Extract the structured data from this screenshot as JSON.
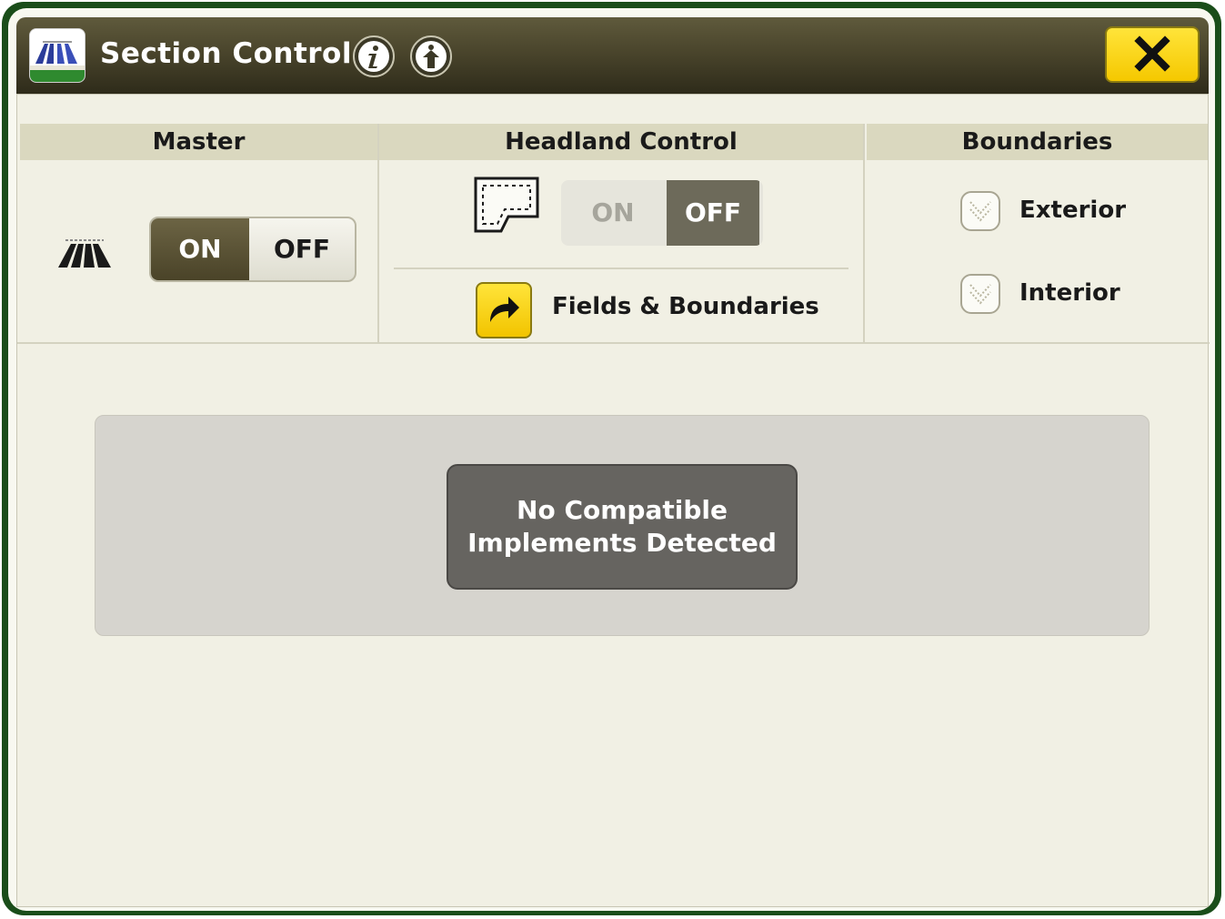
{
  "header": {
    "title": "Section Control",
    "colors": {
      "bar_dark": "#2e2b1a",
      "bar_light": "#5f5a3c",
      "close_yellow": "#f5c800"
    }
  },
  "master": {
    "heading": "Master",
    "toggle_on": "ON",
    "toggle_off": "OFF",
    "selected": "ON"
  },
  "headland": {
    "heading": "Headland Control",
    "toggle_on": "ON",
    "toggle_off": "OFF",
    "selected": "OFF",
    "link_label": "Fields & Boundaries"
  },
  "boundaries": {
    "heading": "Boundaries",
    "options": [
      {
        "label": "Exterior",
        "checked": false
      },
      {
        "label": "Interior",
        "checked": false
      }
    ]
  },
  "status": {
    "message_line1": "No Compatible",
    "message_line2": "Implements Detected"
  },
  "icons": {
    "app": "section-control-app-icon",
    "info": "info-icon",
    "help": "help-icon",
    "close": "close-icon",
    "master": "section-control-icon",
    "headland": "headland-boundary-icon",
    "link": "arrow-forward-icon",
    "checkbox": "checkbox-icon"
  }
}
